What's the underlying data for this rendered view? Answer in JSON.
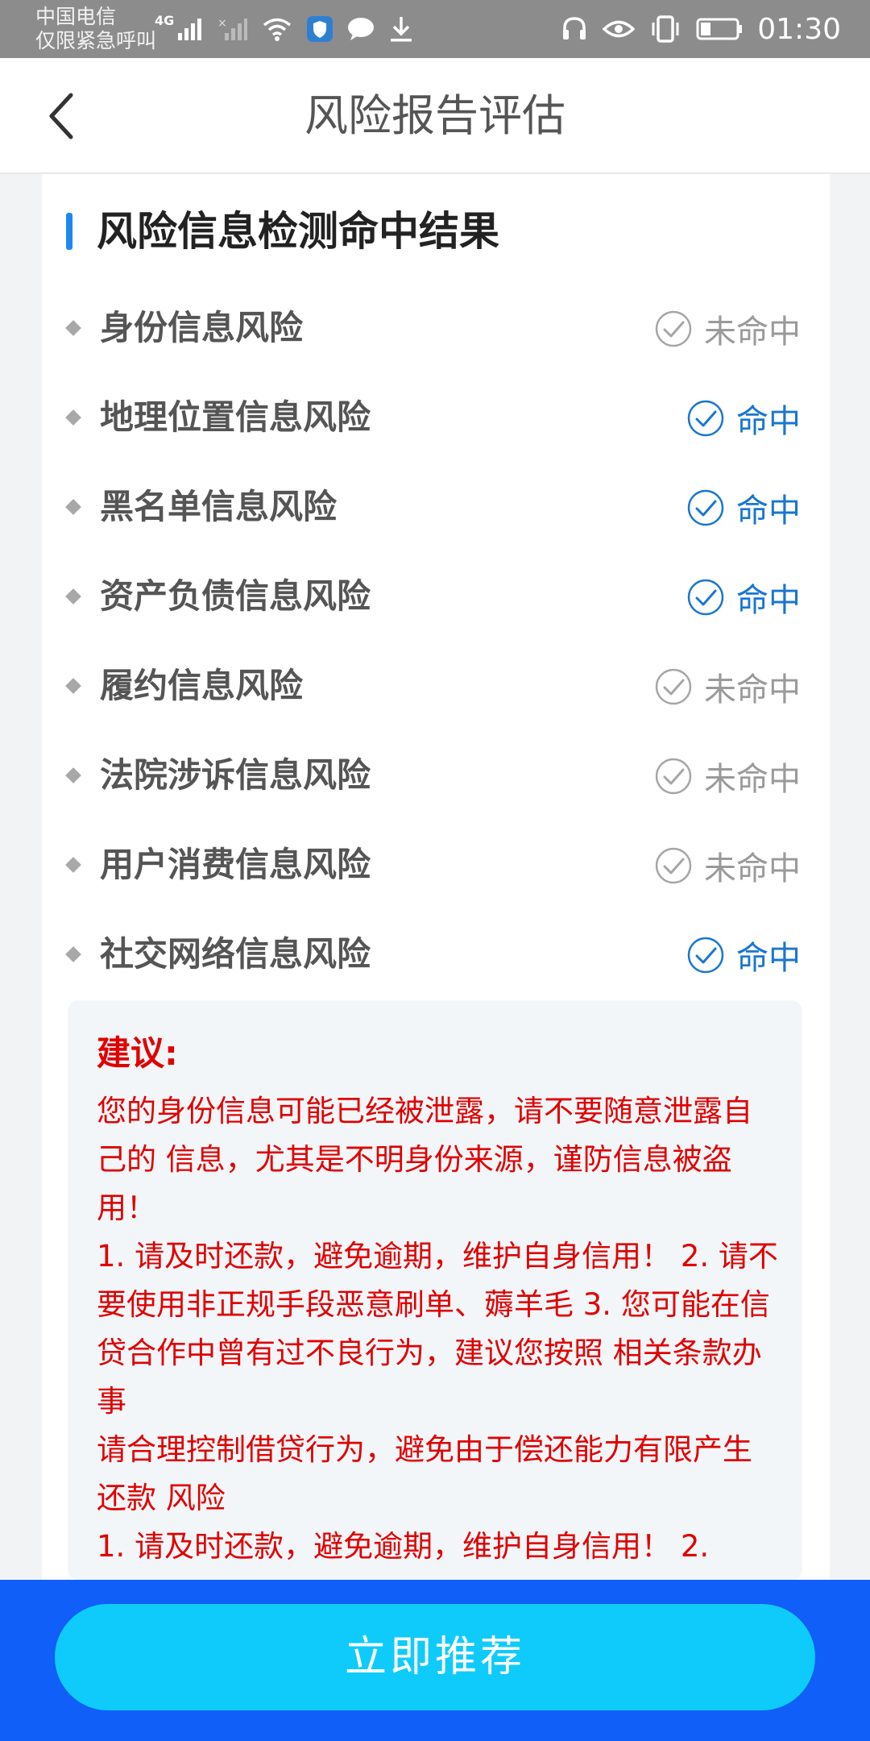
{
  "status_bar": {
    "carrier_line1": "中国电信",
    "carrier_line2": "仅限紧急呼叫",
    "network": "4G",
    "time": "01:30"
  },
  "header": {
    "title": "风险报告评估"
  },
  "section": {
    "title": "风险信息检测命中结果"
  },
  "risks": [
    {
      "label": "身份信息风险",
      "status": "未命中"
    },
    {
      "label": "地理位置信息风险",
      "status": "命中"
    },
    {
      "label": "黑名单信息风险",
      "status": "命中"
    },
    {
      "label": "资产负债信息风险",
      "status": "命中"
    },
    {
      "label": "履约信息风险",
      "status": "未命中"
    },
    {
      "label": "法院涉诉信息风险",
      "status": "未命中"
    },
    {
      "label": "用户消费信息风险",
      "status": "未命中"
    },
    {
      "label": "社交网络信息风险",
      "status": "命中"
    }
  ],
  "advice": {
    "title": "建议:",
    "p1": "您的身份信息可能已经被泄露，请不要随意泄露自己的 信息，尤其是不明身份来源，谨防信息被盗用！",
    "p2": "1. 请及时还款，避免逾期，维护自身信用！ 2. 请不要使用非正规手段恶意刷单、薅羊毛 3. 您可能在信贷合作中曾有过不良行为，建议您按照 相关条款办事",
    "p3": "请合理控制借贷行为，避免由于偿还能力有限产生还款 风险",
    "p4": "1. 请及时还款，避免逾期，维护自身信用！ 2."
  },
  "footer": {
    "button_label": "立即推荐"
  },
  "colors": {
    "hit": "#1976d2",
    "miss": "#9a9a9a",
    "advice_text": "#e00000",
    "button": "#0fcbfb",
    "bottom_bar": "#0f5ff8"
  }
}
